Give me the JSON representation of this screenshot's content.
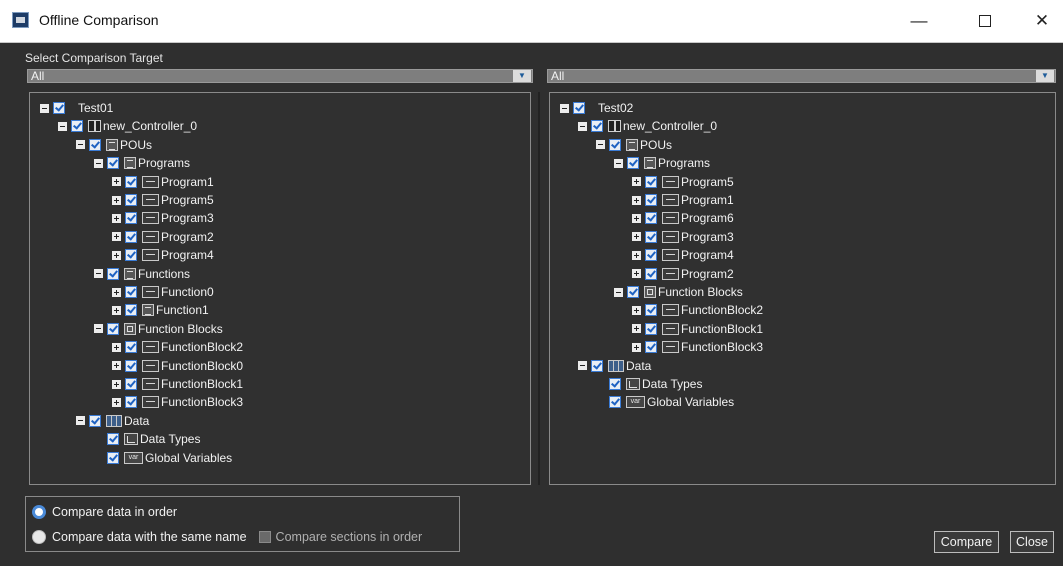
{
  "window": {
    "title": "Offline Comparison",
    "minimize_glyph": "—",
    "close_glyph": "✕"
  },
  "select_label": "Select Comparison Target",
  "left": {
    "dropdown_value": "All",
    "tree": [
      {
        "label": "Test01",
        "depth": 0,
        "expander": "minus",
        "icon": null
      },
      {
        "label": "new_Controller_0",
        "depth": 1,
        "expander": "minus",
        "icon": "controller-icon"
      },
      {
        "label": "POUs",
        "depth": 2,
        "expander": "minus",
        "icon": "pous-icon"
      },
      {
        "label": "Programs",
        "depth": 3,
        "expander": "minus",
        "icon": "programs-icon"
      },
      {
        "label": "Program1",
        "depth": 4,
        "expander": "plus",
        "icon": "program-icon"
      },
      {
        "label": "Program5",
        "depth": 4,
        "expander": "plus",
        "icon": "program-icon"
      },
      {
        "label": "Program3",
        "depth": 4,
        "expander": "plus",
        "icon": "program-icon"
      },
      {
        "label": "Program2",
        "depth": 4,
        "expander": "plus",
        "icon": "program-icon"
      },
      {
        "label": "Program4",
        "depth": 4,
        "expander": "plus",
        "icon": "program-icon"
      },
      {
        "label": "Functions",
        "depth": 3,
        "expander": "minus",
        "icon": "functions-icon"
      },
      {
        "label": "Function0",
        "depth": 4,
        "expander": "plus",
        "icon": "program-icon"
      },
      {
        "label": "Function1",
        "depth": 4,
        "expander": "plus",
        "icon": "function-icon"
      },
      {
        "label": "Function Blocks",
        "depth": 3,
        "expander": "minus",
        "icon": "function-blocks-icon"
      },
      {
        "label": "FunctionBlock2",
        "depth": 4,
        "expander": "plus",
        "icon": "program-icon"
      },
      {
        "label": "FunctionBlock0",
        "depth": 4,
        "expander": "plus",
        "icon": "program-icon"
      },
      {
        "label": "FunctionBlock1",
        "depth": 4,
        "expander": "plus",
        "icon": "program-icon"
      },
      {
        "label": "FunctionBlock3",
        "depth": 4,
        "expander": "plus",
        "icon": "program-icon"
      },
      {
        "label": "Data",
        "depth": 2,
        "expander": "minus",
        "icon": "data-icon"
      },
      {
        "label": "Data Types",
        "depth": 3,
        "expander": null,
        "icon": "data-types-icon"
      },
      {
        "label": "Global Variables",
        "depth": 3,
        "expander": null,
        "icon": "global-variables-icon"
      }
    ]
  },
  "right": {
    "dropdown_value": "All",
    "tree": [
      {
        "label": "Test02",
        "depth": 0,
        "expander": "minus",
        "icon": null
      },
      {
        "label": "new_Controller_0",
        "depth": 1,
        "expander": "minus",
        "icon": "controller-icon"
      },
      {
        "label": "POUs",
        "depth": 2,
        "expander": "minus",
        "icon": "pous-icon"
      },
      {
        "label": "Programs",
        "depth": 3,
        "expander": "minus",
        "icon": "programs-icon"
      },
      {
        "label": "Program5",
        "depth": 4,
        "expander": "plus",
        "icon": "program-icon"
      },
      {
        "label": "Program1",
        "depth": 4,
        "expander": "plus",
        "icon": "program-icon"
      },
      {
        "label": "Program6",
        "depth": 4,
        "expander": "plus",
        "icon": "program-icon"
      },
      {
        "label": "Program3",
        "depth": 4,
        "expander": "plus",
        "icon": "program-icon"
      },
      {
        "label": "Program4",
        "depth": 4,
        "expander": "plus",
        "icon": "program-icon"
      },
      {
        "label": "Program2",
        "depth": 4,
        "expander": "plus",
        "icon": "program-icon"
      },
      {
        "label": "Function Blocks",
        "depth": 3,
        "expander": "minus",
        "icon": "function-blocks-icon"
      },
      {
        "label": "FunctionBlock2",
        "depth": 4,
        "expander": "plus",
        "icon": "program-icon"
      },
      {
        "label": "FunctionBlock1",
        "depth": 4,
        "expander": "plus",
        "icon": "program-icon"
      },
      {
        "label": "FunctionBlock3",
        "depth": 4,
        "expander": "plus",
        "icon": "program-icon"
      },
      {
        "label": "Data",
        "depth": 1,
        "expander": "minus",
        "icon": "data-icon"
      },
      {
        "label": "Data Types",
        "depth": 2,
        "expander": null,
        "icon": "data-types-icon"
      },
      {
        "label": "Global Variables",
        "depth": 2,
        "expander": null,
        "icon": "global-variables-icon"
      }
    ]
  },
  "options": {
    "in_order_label": "Compare data in order",
    "same_name_label": "Compare data with the same name",
    "sections_label": "Compare sections in order",
    "selected": "in_order"
  },
  "buttons": {
    "compare": "Compare",
    "close": "Close"
  },
  "colors": {
    "background": "#2f2f2f",
    "checkbox_accent": "#1e62c2",
    "radio_selected": "#4a8ad8"
  }
}
